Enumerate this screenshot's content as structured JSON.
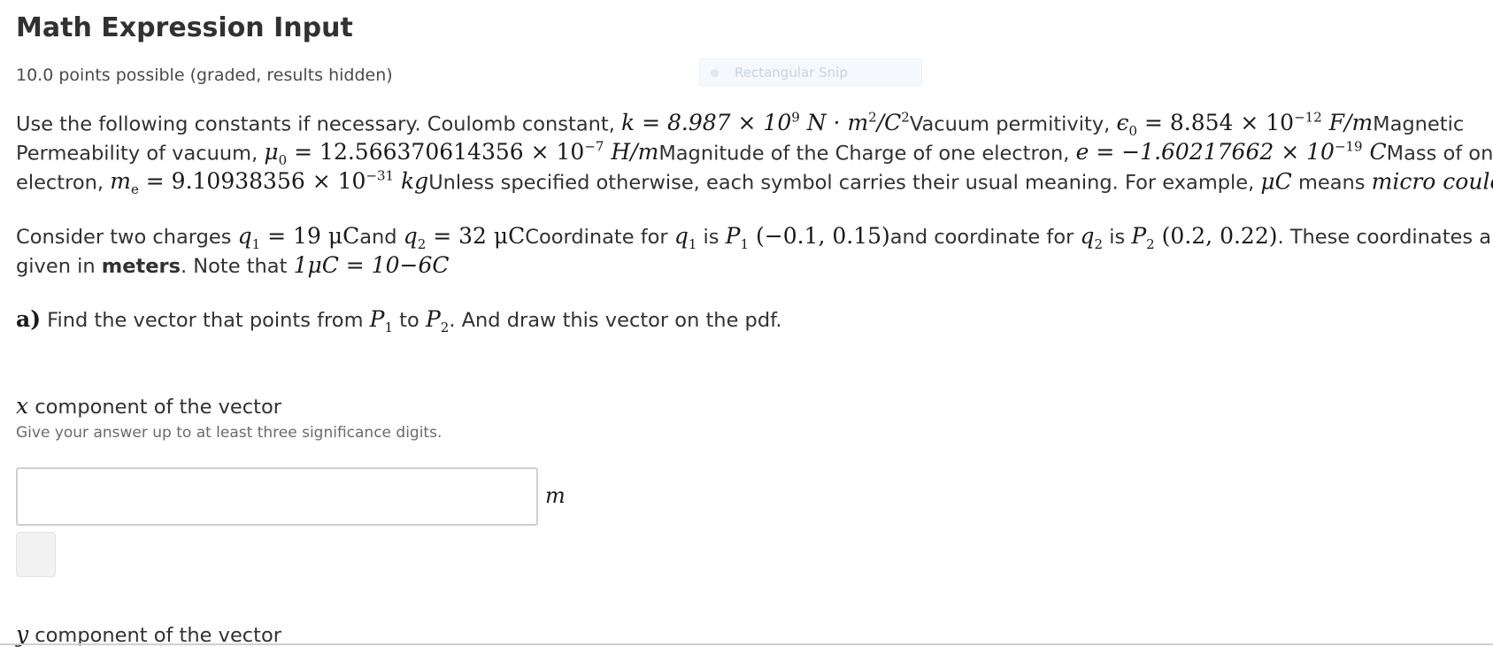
{
  "problem": {
    "title": "Math Expression Input",
    "points": "10.0 points possible (graded, results hidden)"
  },
  "overlay": {
    "snip_label": "Rectangular Snip"
  },
  "constants": {
    "intro": "Use the following constants if necessary. Coulomb constant, ",
    "k": "k = 8.987 × 10",
    "k_exp": "9",
    "k_unit": " N · m",
    "k_unit_exp": "2",
    "k_unit_tail": "/C",
    "k_tail_exp": "2",
    "vac_label": "Vacuum permitivity, ",
    "eps": "ϵ",
    "eps_sub": "0",
    "eps_val": " = 8.854 × 10",
    "eps_exp": "−12",
    "eps_unit": " F/m",
    "mag_label": "Magnetic",
    "perm_label": "Permeability of vacuum, ",
    "mu": "μ",
    "mu_sub": "0",
    "mu_val": " = 12.566370614356 × 10",
    "mu_exp": "−7",
    "mu_unit": " H/m",
    "charge_label": "Magnitude of the Charge of one electron, ",
    "e_val": "e = −1.60217662 × 10",
    "e_exp": "−19",
    "e_unit": " C",
    "mass_label": "Mass of one",
    "electron_label": "electron, ",
    "me": "m",
    "me_sub": "e",
    "me_val": " = 9.10938356 × 10",
    "me_exp": "−31",
    "me_unit": " kg",
    "usual": "Unless specified otherwise, each symbol carries their usual meaning. For example, ",
    "muC": "μC",
    "means": " means ",
    "micro": "micro coulomb"
  },
  "scenario": {
    "a": "Consider two charges ",
    "q1": "q",
    "q1_sub": "1",
    "q1_val": " = 19 μC",
    "and1": "and ",
    "q2": "q",
    "q2_sub": "2",
    "q2_val": " = 32 μC",
    "coord1": "Coordinate for ",
    "is1": " is ",
    "p1": "P",
    "p1_sub": "1",
    "p1_val": " (−0.1, 0.15)",
    "coord2": "and coordinate for ",
    "is2": " is ",
    "p2": "P",
    "p2_sub": "2",
    "p2_val": " (0.2, 0.22)",
    "tail": ". These coordinates are",
    "given": "given in ",
    "meters": "meters",
    "note": ". Note that ",
    "conv": "1μC = 10",
    "conv_tail": "−6C"
  },
  "part_a": {
    "label": "a)",
    "text1": " Find the vector that points from ",
    "p1": "P",
    "p1_sub": "1",
    "to": " to ",
    "p2": "P",
    "p2_sub": "2",
    "text2": ". And draw this vector on the pdf."
  },
  "x_component": {
    "var": "x",
    "title": " component of the vector",
    "hint": "Give your answer up to at least three significance digits.",
    "value": "",
    "unit": "m"
  },
  "y_component": {
    "var": "y",
    "title": " component of the vector"
  }
}
